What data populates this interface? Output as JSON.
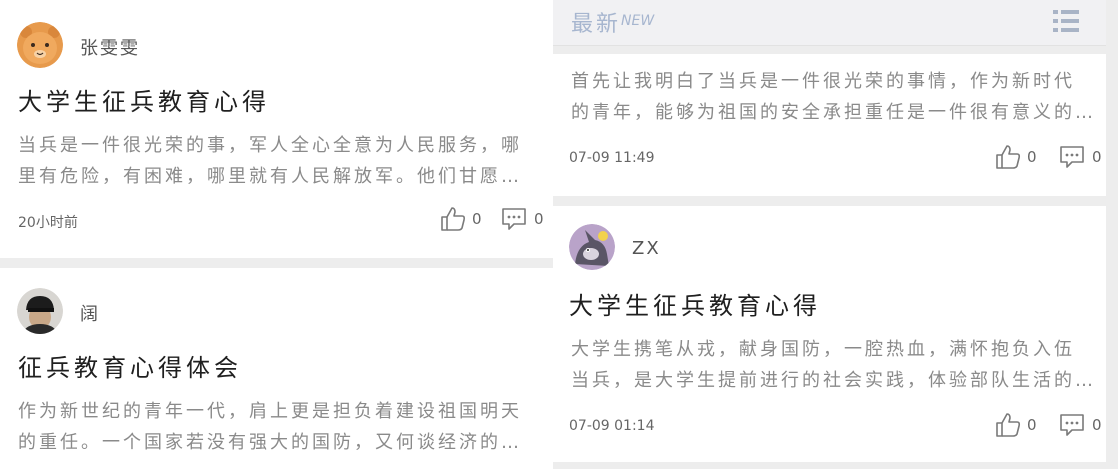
{
  "latest_header": {
    "label_cn": "最新",
    "label_en": "NEW",
    "menu_icon": "list-menu-icon"
  },
  "cards": [
    {
      "author": "张雯雯",
      "avatar": "cartoon-bear-avatar",
      "title": "大学生征兵教育心得",
      "excerpt": "当兵是一件很光荣的事，军人全心全意为人民服务，哪里有危险，有困难，哪里就有人民解放军。他们甘愿为人民牺牲自己……",
      "time": "20小时前",
      "likes": "0",
      "comments": "0"
    },
    {
      "author": "阔",
      "avatar": "person-cap-avatar",
      "title": "征兵教育心得体会",
      "excerpt": "作为新世纪的青年一代，肩上更是担负着建设祖国明天的重任。一个国家若没有强大的国防，又何谈经济的发展……",
      "time": "",
      "likes": "",
      "comments": ""
    },
    {
      "author": "",
      "avatar": "",
      "title": "",
      "excerpt": "首先让我明白了当兵是一件很光荣的事情，作为新时代的青年，能够为祖国的安全承担重任是一件很有意义的事情……",
      "time": "07-09 11:49",
      "likes": "0",
      "comments": "0"
    },
    {
      "author": "ZX",
      "avatar": "cartoon-cat-avatar",
      "title": "大学生征兵教育心得",
      "excerpt": "大学生携笔从戎，献身国防，一腔热血，满怀抱负入伍当兵，是大学生提前进行的社会实践，体验部队生活的好机会……",
      "time": "07-09 01:14",
      "likes": "0",
      "comments": "0"
    }
  ],
  "colors": {
    "title": "#1f1f1f",
    "excerpt": "#8a8a8a",
    "meta": "#666666",
    "divider": "#ededed",
    "accent_blue": "#a7b6cf"
  }
}
